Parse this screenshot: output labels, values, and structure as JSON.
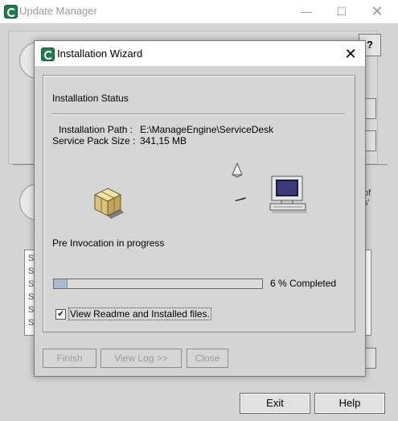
{
  "update_manager": {
    "title": "Update Manager",
    "minimize_glyph": "—",
    "maximize_glyph": "☐",
    "close_glyph": "✕",
    "help_glyph": "?",
    "side_text": "of\ns'",
    "list_rows": [
      "S",
      "S",
      "S",
      "S",
      "S",
      "S"
    ],
    "exit_label": "Exit",
    "help_label": "Help"
  },
  "wizard": {
    "title": "Installation Wizard",
    "close_glyph": "✕",
    "status_heading": "Installation Status",
    "install_path_label": "Installation Path :",
    "install_path_value": "E:\\ManageEngine\\ServiceDesk",
    "sp_size_label": "Service Pack Size :",
    "sp_size_value": "341,15 MB",
    "invocation_status": "Pre Invocation in progress",
    "progress_percent": 6,
    "progress_text": "6 % Completed",
    "readme_checked": true,
    "readme_label": "View Readme and Installed files.",
    "finish_label": "Finish",
    "view_log_label": "View Log >>",
    "close_label": "Close"
  },
  "icons": {
    "app_logo": "manageengine-logo-icon",
    "box": "package-box-icon",
    "disc": "disc-icon",
    "computer": "computer-icon"
  },
  "colors": {
    "progress_fill": "#a8bccf",
    "logo_green": "#1e7d4a"
  }
}
